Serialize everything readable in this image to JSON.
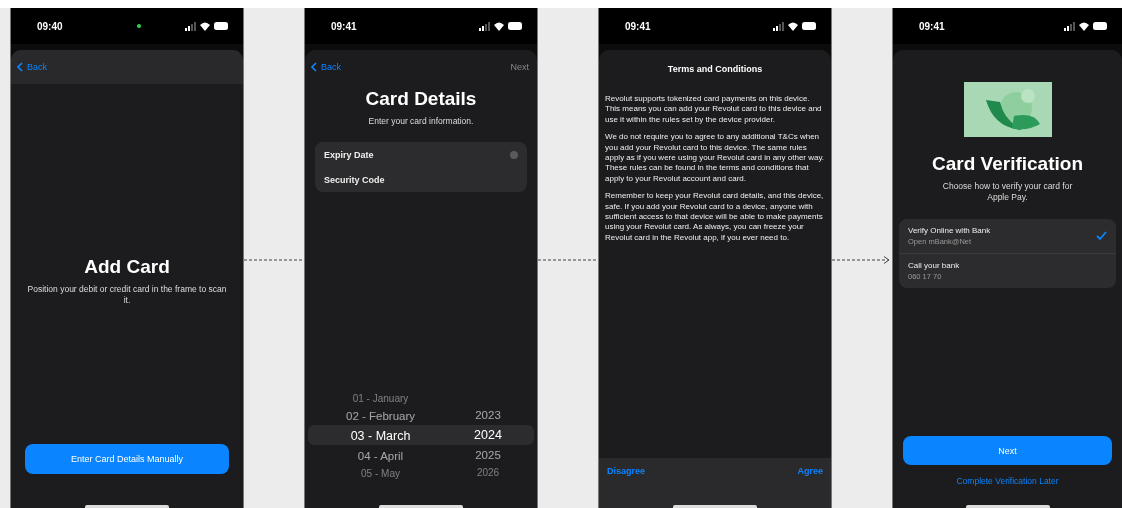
{
  "screens": [
    {
      "kind": "add_card",
      "status_time": "09:40",
      "recording_indicator": true,
      "back_label": "Back",
      "title": "Add Card",
      "subtitle": "Position your debit or credit card in the frame to scan it.",
      "primary_button": "Enter Card Details Manually"
    },
    {
      "kind": "card_details",
      "status_time": "09:41",
      "recording_indicator": false,
      "back_label": "Back",
      "next_label": "Next",
      "next_disabled": true,
      "title": "Card Details",
      "subtitle": "Enter your card information.",
      "fields": [
        {
          "label": "Expiry Date",
          "clearable": true
        },
        {
          "label": "Security Code",
          "clearable": false
        }
      ],
      "months": [
        {
          "label": "01 - January",
          "selected": false
        },
        {
          "label": "02 - February",
          "selected": false
        },
        {
          "label": "03 - March",
          "selected": true
        },
        {
          "label": "04 - April",
          "selected": false
        },
        {
          "label": "05 - May",
          "selected": false
        }
      ],
      "years": [
        {
          "label": "2023",
          "selected": false
        },
        {
          "label": "2024",
          "selected": true
        },
        {
          "label": "2025",
          "selected": false
        },
        {
          "label": "2026",
          "selected": false
        }
      ]
    },
    {
      "kind": "terms",
      "status_time": "09:41",
      "recording_indicator": false,
      "title": "Terms and Conditions",
      "paragraphs": [
        "Revolut supports tokenized card payments on this device. This means you can add your Revolut card to this device and use it within the rules set by the device provider.",
        "We do not require you to agree to any additional T&Cs when you add your Revolut card to this device. The same rules apply as if you were using your Revolut card in any other way. These rules can be found in the terms and conditions that apply to your Revolut account and card.",
        "Remember to keep your Revolut card details, and this device, safe. If you add your Revolut card to a device, anyone with sufficient access to that device will be able to make payments using your Revolut card. As always, you can freeze your Revolut card in the Revolut app, if you ever need to."
      ],
      "left_action": "Disagree",
      "right_action": "Agree"
    },
    {
      "kind": "verification",
      "status_time": "09:41",
      "recording_indicator": false,
      "title": "Card Verification",
      "subtitle": "Choose how to verify your card for Apple Pay.",
      "options": [
        {
          "title": "Verify Online with Bank",
          "detail": "Open mBank@Net",
          "selected": true
        },
        {
          "title": "Call your bank",
          "detail": "060 17 70",
          "selected": false
        }
      ],
      "primary_button": "Next",
      "link": "Complete Verification Later"
    }
  ]
}
